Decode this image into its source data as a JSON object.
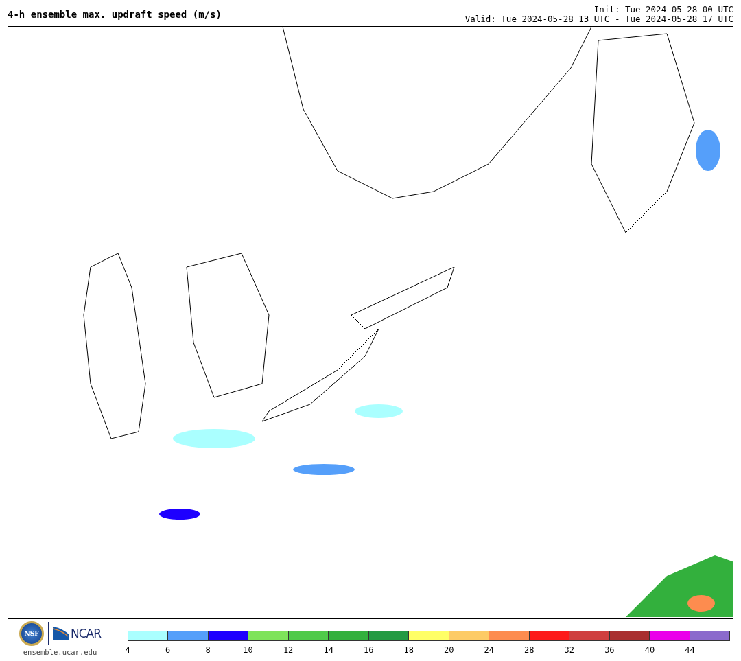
{
  "header": {
    "title": "4-h ensemble max. updraft speed (m/s)",
    "init": "Init: Tue 2024-05-28 00 UTC",
    "valid": "Valid: Tue 2024-05-28 13 UTC - Tue 2024-05-28 17 UTC"
  },
  "footer": {
    "nsf": "NSF",
    "ncar": "NCAR",
    "site": "ensemble.ucar.edu"
  },
  "legend": {
    "bins": [
      {
        "label": "4",
        "color": "#aaffff"
      },
      {
        "label": "6",
        "color": "#559ffa"
      },
      {
        "label": "8",
        "color": "#1e00ff"
      },
      {
        "label": "10",
        "color": "#7ee35a"
      },
      {
        "label": "12",
        "color": "#4fca4a"
      },
      {
        "label": "14",
        "color": "#33b03d"
      },
      {
        "label": "16",
        "color": "#229a42"
      },
      {
        "label": "18",
        "color": "#ffff66"
      },
      {
        "label": "20",
        "color": "#fdcb66"
      },
      {
        "label": "24",
        "color": "#fd8c4f"
      },
      {
        "label": "28",
        "color": "#fd1b1b"
      },
      {
        "label": "32",
        "color": "#cf3f3f"
      },
      {
        "label": "36",
        "color": "#a92f2f"
      },
      {
        "label": "40",
        "color": "#ea00ea"
      },
      {
        "label": "44",
        "color": "#8b6acc"
      }
    ]
  }
}
